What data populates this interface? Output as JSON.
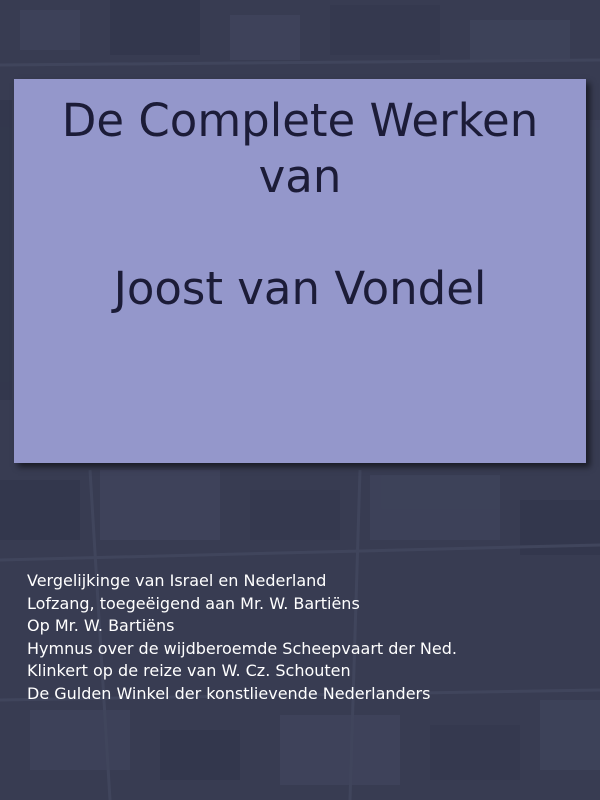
{
  "cover": {
    "title_line1": "De Complete Werken",
    "title_line2": "van",
    "author": "Joost van Vondel",
    "background_color": "#383c52",
    "panel_color": "#9497cb",
    "title_color": "#1c1c38"
  },
  "contents": [
    "Vergelijkinge van Israel en Nederland",
    "Lofzang, toegeëigend aan Mr. W. Bartiëns",
    "Op Mr. W. Bartiëns",
    "Hymnus over de wijdberoemde Scheepvaart der Ned.",
    "Klinkert op de reize van W. Cz. Schouten",
    "De Gulden Winkel der konstlievende Nederlanders"
  ]
}
